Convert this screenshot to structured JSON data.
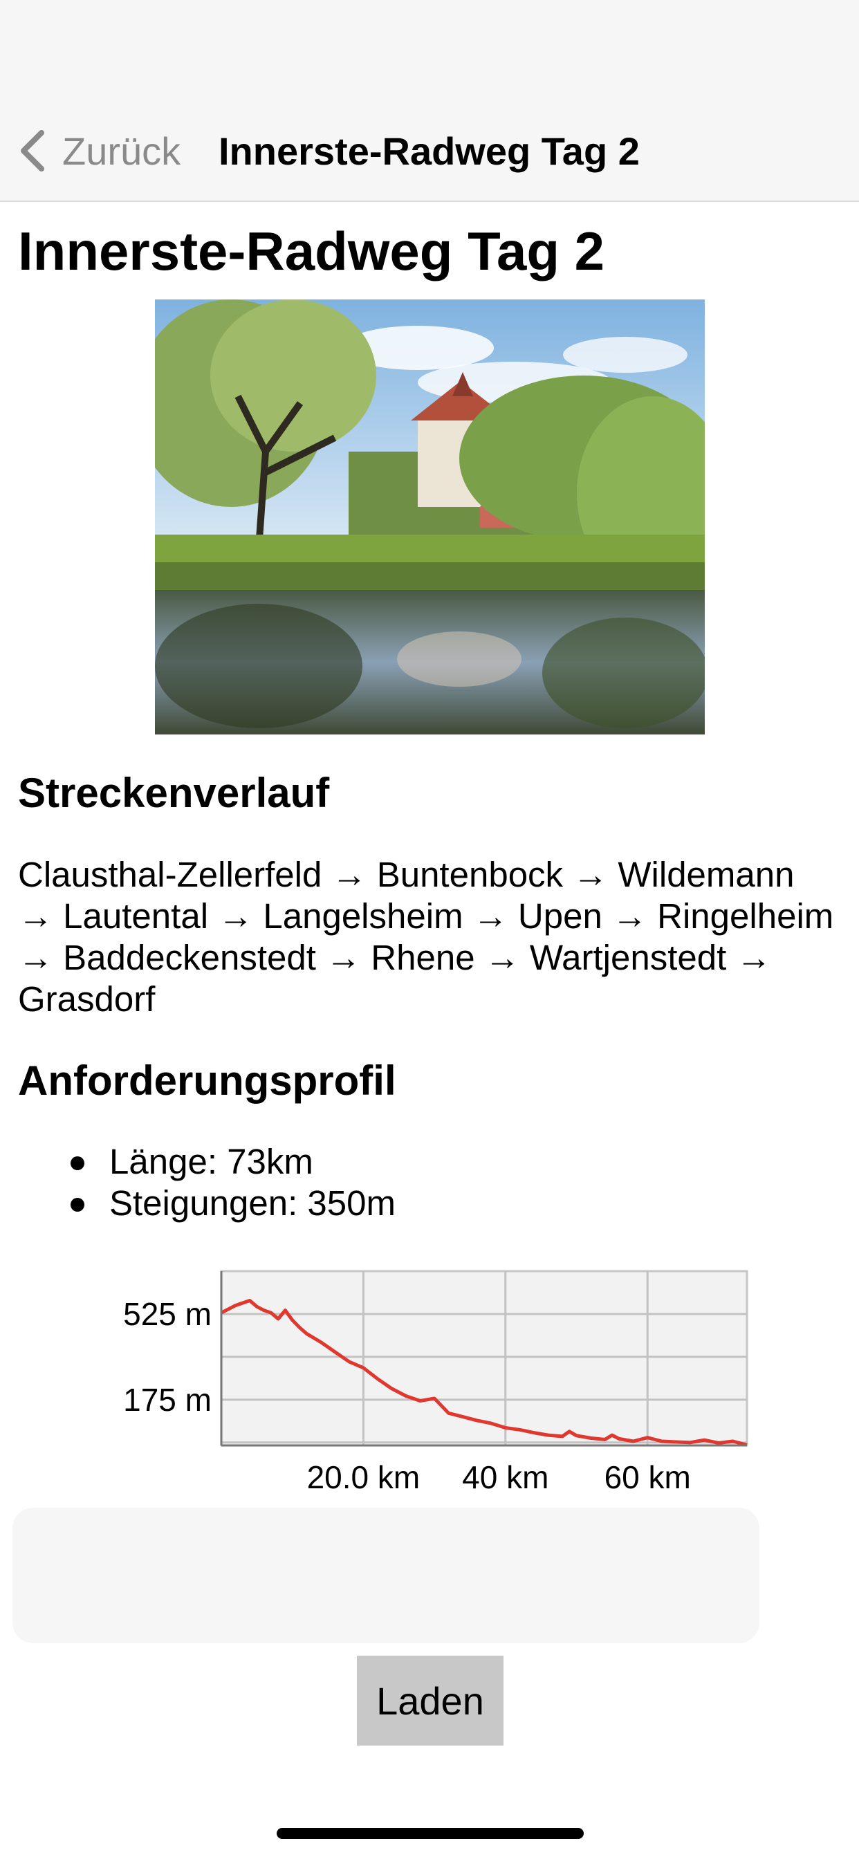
{
  "navbar": {
    "back_label": "Zurück",
    "title": "Innerste-Radweg Tag 2"
  },
  "page": {
    "title": "Innerste-Radweg Tag 2"
  },
  "route": {
    "heading": "Streckenverlauf",
    "text": "Clausthal-Zellerfeld → Buntenbock → Wildemann → Lautental → Langelsheim → Upen → Ringelheim → Baddeckenstedt → Rhene → Wartjenstedt → Grasdorf"
  },
  "requirements": {
    "heading": "Anforderungsprofil",
    "items": [
      "Länge: 73km",
      "Steigungen: 350m"
    ]
  },
  "chart_data": {
    "type": "line",
    "title": "",
    "xlabel": "",
    "ylabel": "",
    "x_ticks": [
      "20.0 km",
      "40 km",
      "60 km"
    ],
    "y_ticks": [
      "525 m",
      "175 m"
    ],
    "xlim": [
      0,
      74
    ],
    "ylim": [
      -12,
      700
    ],
    "grid": true,
    "color": "#e0372f",
    "series": [
      {
        "x": [
          0,
          2,
          4,
          5,
          6,
          7,
          8,
          9,
          10,
          11,
          12,
          14,
          16,
          18,
          20,
          22,
          24,
          26,
          28,
          30,
          31,
          32,
          34,
          36,
          38,
          40,
          42,
          44,
          46,
          48,
          49,
          50,
          52,
          54,
          55,
          56,
          58,
          60,
          62,
          64,
          66,
          68,
          70,
          72,
          74
        ],
        "y": [
          530,
          560,
          580,
          555,
          540,
          530,
          505,
          540,
          500,
          470,
          445,
          410,
          370,
          330,
          305,
          260,
          220,
          190,
          170,
          180,
          150,
          120,
          105,
          90,
          78,
          60,
          52,
          40,
          30,
          25,
          45,
          28,
          18,
          12,
          30,
          15,
          5,
          20,
          5,
          2,
          0,
          10,
          -2,
          5,
          -10
        ]
      }
    ]
  },
  "actions": {
    "load_label": "Laden"
  }
}
